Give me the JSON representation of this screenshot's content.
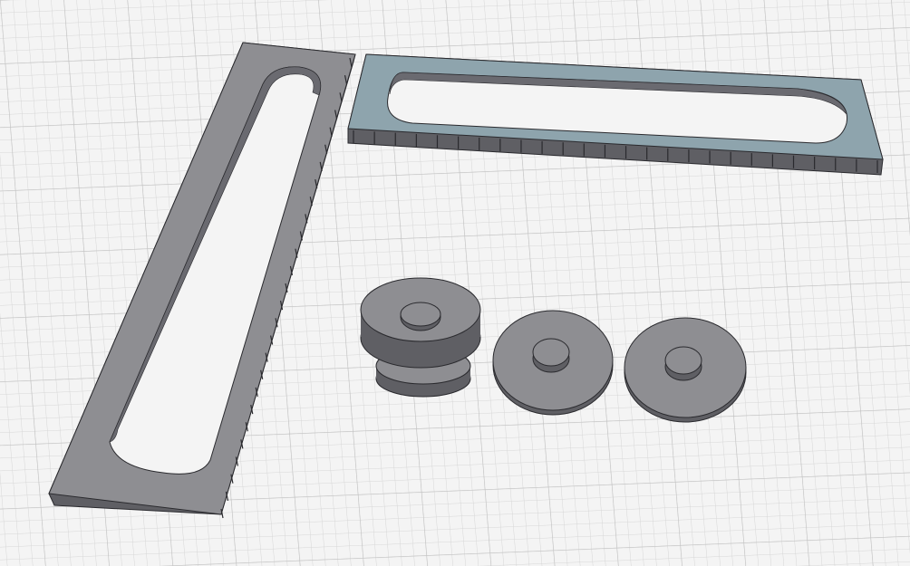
{
  "scene": {
    "background_color": "#f4f4f4",
    "grid": {
      "visible": true,
      "minor_color": "#d6d6d6",
      "major_color": "#c2c2c2"
    },
    "colors": {
      "part_top": "#8e8e92",
      "part_side": "#5f5f64",
      "part_inner_wall": "#6a6a70",
      "selected_top": "#8ea4ad",
      "edge": "#2a2a2e"
    },
    "objects": [
      {
        "id": "rail-left",
        "type": "slotted-bar",
        "orientation": "diagonal",
        "selected": false,
        "notches": 27
      },
      {
        "id": "rail-right",
        "type": "slotted-bar",
        "orientation": "horizontal",
        "selected": true,
        "notches": 26
      },
      {
        "id": "double-washer",
        "type": "stacked-disc",
        "selected": false
      },
      {
        "id": "disc-middle",
        "type": "stepped-disc",
        "selected": false
      },
      {
        "id": "disc-right",
        "type": "stepped-disc",
        "selected": false
      }
    ]
  }
}
